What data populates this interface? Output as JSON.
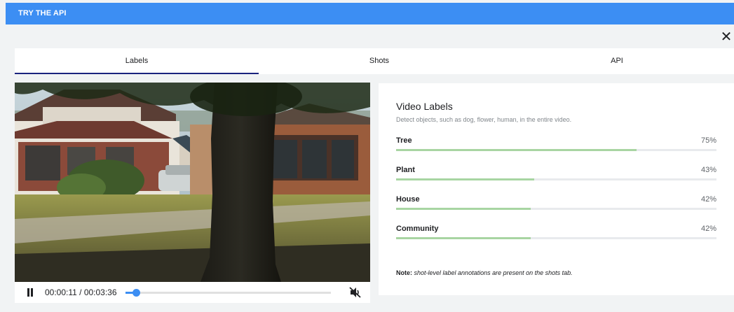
{
  "header": {
    "title": "TRY THE API"
  },
  "dialog": {
    "close_glyph": "✕"
  },
  "tabs": [
    {
      "label": "Labels",
      "active": true
    },
    {
      "label": "Shots",
      "active": false
    },
    {
      "label": "API",
      "active": false
    }
  ],
  "player": {
    "state": "playing",
    "time_display": "00:00:11 / 00:03:36",
    "progress": 0.051,
    "muted": true,
    "icons": {
      "pause": "pause-icon",
      "mute": "volume-off-icon"
    }
  },
  "labels_panel": {
    "title": "Video Labels",
    "subtitle": "Detect objects, such as dog, flower, human, in the entire video.",
    "labels": [
      {
        "name": "Tree",
        "percent_text": "75%",
        "value": 0.75
      },
      {
        "name": "Plant",
        "percent_text": "43%",
        "value": 0.43
      },
      {
        "name": "House",
        "percent_text": "42%",
        "value": 0.42
      },
      {
        "name": "Community",
        "percent_text": "42%",
        "value": 0.42
      }
    ],
    "note_label": "Note:",
    "note_text": "shot-level label annotations are present on the shots tab."
  },
  "colors": {
    "header": "#3c8ef3",
    "active_tab_underline": "#1a237e",
    "bar_fill": "#a8d5a2",
    "progress": "#3c8ef3"
  }
}
